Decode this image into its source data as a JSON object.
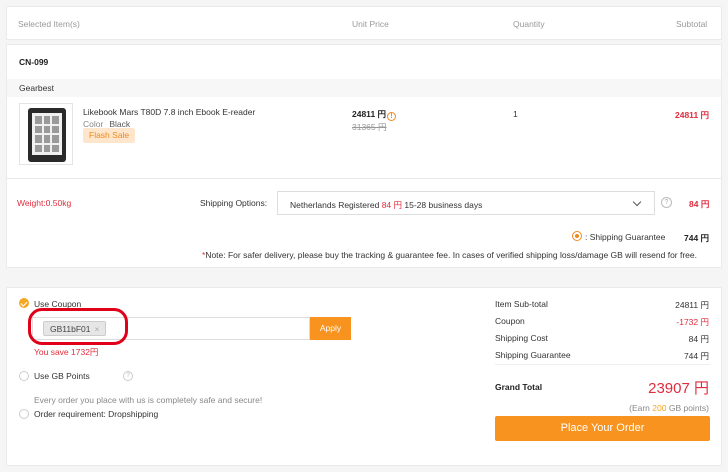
{
  "header": {
    "selected_items": "Selected Item(s)",
    "unit_price": "Unit Price",
    "quantity": "Quantity",
    "subtotal": "Subtotal"
  },
  "order": {
    "id": "CN-099",
    "seller": "Gearbest",
    "product": {
      "name": "Likebook Mars T80D 7.8 inch Ebook E-reader",
      "color_label": "Color",
      "color_value": "Black",
      "badge": "Flash Sale",
      "price": "24811 円",
      "old_price": "31365 円",
      "quantity": "1",
      "subtotal": "24811 円"
    },
    "weight": "Weight:0.50kg",
    "shipping_options_label": "Shipping Options:",
    "shipping_option_name": "Netherlands Registered",
    "shipping_option_price": "84 円",
    "shipping_option_days": "15-28 business days",
    "shipping_fee": "84 円",
    "shipping_guarantee_label": ": Shipping Guarantee",
    "shipping_guarantee_fee": "744 円",
    "note_prefix": "*",
    "note": "Note: For safer delivery, please buy the tracking & guarantee fee. In cases of verified shipping loss/damage GB will resend for free."
  },
  "coupon": {
    "label": "Use Coupon",
    "code": "GB11bF01",
    "apply_label": "Apply",
    "save_text": "You save 1732円"
  },
  "gb_points": {
    "label": "Use GB Points"
  },
  "safe_text": "Every order you place with us is completely safe and secure!",
  "dropshipping_label": "Order requirement: Dropshipping",
  "summary": {
    "rows": [
      {
        "label": "Item Sub-total",
        "value": "24811 円"
      },
      {
        "label": "Coupon",
        "value": "-1732 円"
      },
      {
        "label": "Shipping Cost",
        "value": "84 円"
      },
      {
        "label": "Shipping Guarantee",
        "value": "744 円"
      }
    ],
    "grand_total_label": "Grand Total",
    "grand_total": "23907 円",
    "earn_prefix": "(Earn ",
    "earn_points": "200",
    "earn_suffix": " GB points)",
    "place_order_label": "Place Your Order"
  },
  "colors": {
    "accent": "#f7931e",
    "price_red": "#e02c3c",
    "highlight_ring": "#e0001a"
  }
}
